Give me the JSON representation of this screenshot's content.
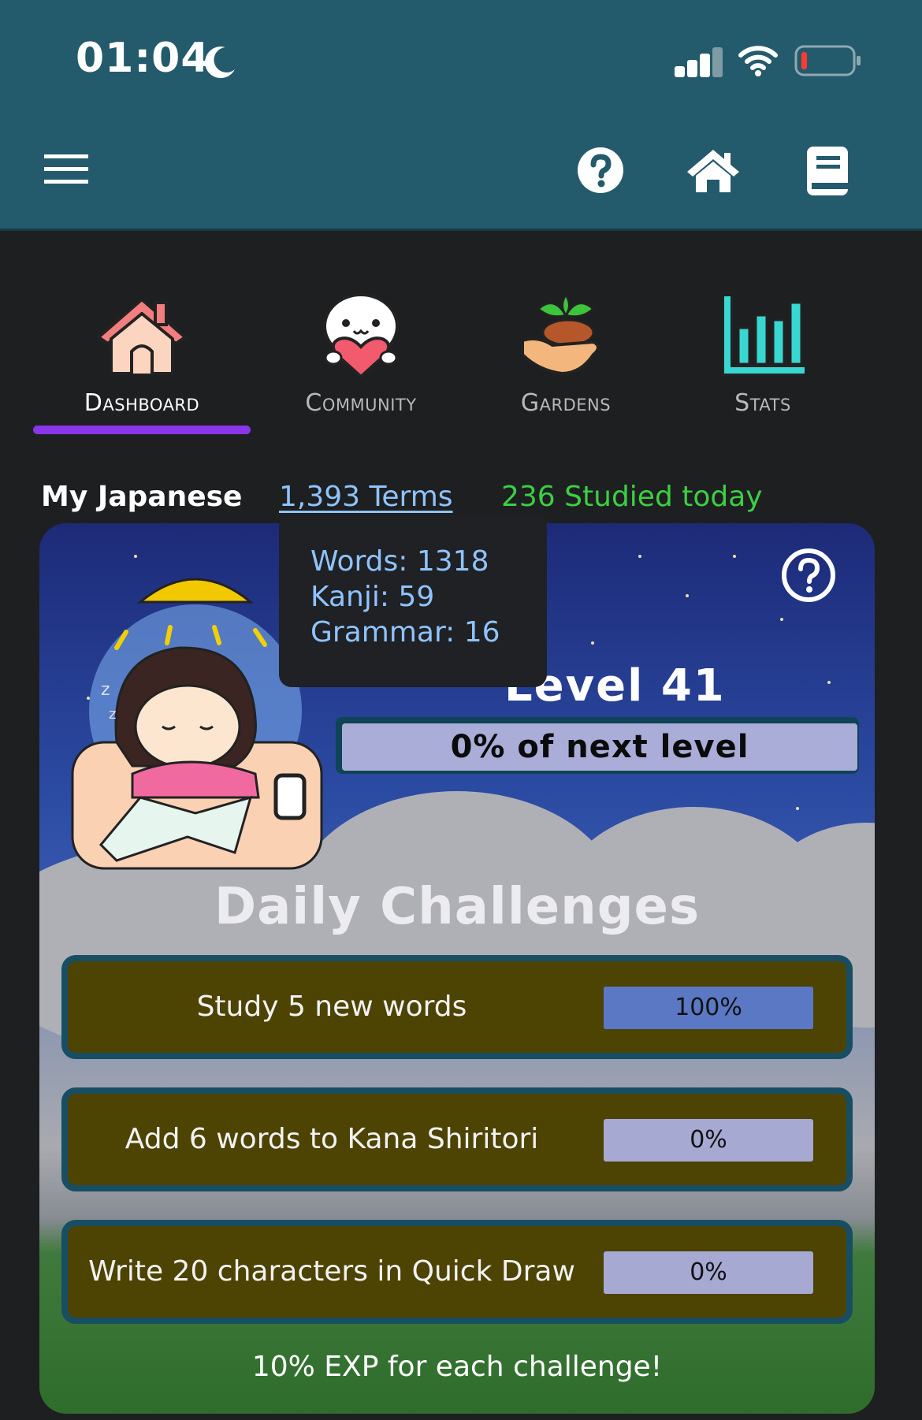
{
  "status_bar": {
    "time": "01:04"
  },
  "app_bar": {
    "menu_icon": "hamburger-menu-icon",
    "help_icon": "help-circle-icon",
    "home_icon": "home-icon",
    "book_icon": "book-icon"
  },
  "tabs": [
    {
      "label": "Dashboard",
      "icon": "house-icon",
      "active": true
    },
    {
      "label": "Community",
      "icon": "heart-mascot-icon",
      "active": false
    },
    {
      "label": "Gardens",
      "icon": "sprout-hand-icon",
      "active": false
    },
    {
      "label": "Stats",
      "icon": "bar-chart-icon",
      "active": false
    }
  ],
  "summary": {
    "language": "My Japanese",
    "terms": "1,393 Terms",
    "studied_today": "236 Studied today"
  },
  "tooltip": {
    "words": "Words: 1318",
    "kanji": "Kanji: 59",
    "grammar": "Grammar: 16"
  },
  "level": {
    "label": "Level 41",
    "progress_text": "0% of next level",
    "progress": 0
  },
  "daily": {
    "title": "Daily Challenges",
    "challenges": [
      {
        "text": "Study 5 new words",
        "percent_text": "100%",
        "progress": 1.0
      },
      {
        "text": "Add 6 words to Kana Shiritori",
        "percent_text": "0%",
        "progress": 0.0
      },
      {
        "text": "Write 20 characters in Quick Draw",
        "percent_text": "0%",
        "progress": 0.0
      }
    ],
    "footer": "10% EXP for each challenge!"
  },
  "colors": {
    "header": "#245b6c",
    "tab_underline": "#8a35e8",
    "terms_link": "#8fc3ff",
    "studied_green": "#3ccf43",
    "challenge_bg": "#4d4303"
  }
}
